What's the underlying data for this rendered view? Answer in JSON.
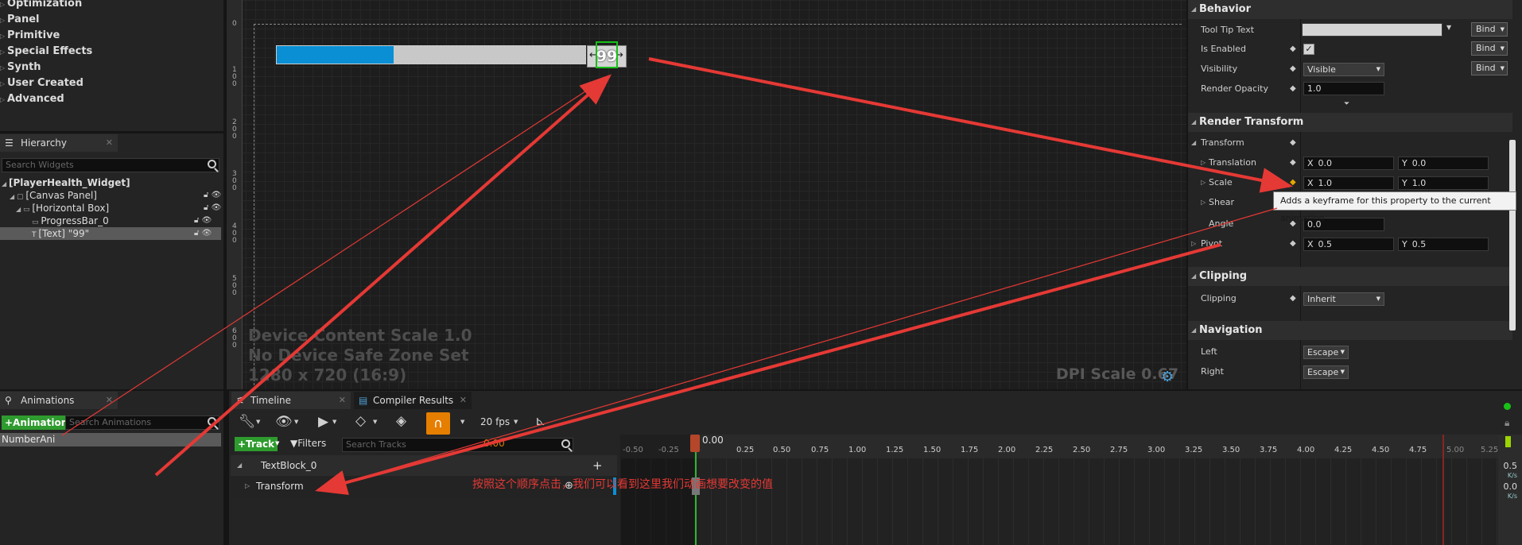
{
  "palette": {
    "items": [
      "Optimization",
      "Panel",
      "Primitive",
      "Special Effects",
      "Synth",
      "User Created",
      "Advanced"
    ]
  },
  "hierarchy": {
    "tab_label": "Hierarchy",
    "search_placeholder": "Search Widgets",
    "nodes": [
      "[PlayerHealth_Widget]",
      "[Canvas Panel]",
      "[Horizontal Box]",
      "ProgressBar_0",
      "[Text] \"99\""
    ]
  },
  "designer": {
    "text_value": "99",
    "progress_percent": 38,
    "info_lines": [
      "Device Content Scale 1.0",
      "No Device Safe Zone Set",
      "1280 x 720 (16:9)"
    ],
    "dpi_label": "DPI Scale 0.67",
    "ruler_labels": [
      "0",
      "1",
      "0",
      "0",
      "2",
      "0",
      "0",
      "3",
      "0",
      "0",
      "4",
      "0",
      "0",
      "5",
      "0",
      "0",
      "6",
      "0",
      "0"
    ]
  },
  "details": {
    "behavior": {
      "title": "Behavior",
      "tooltip_label": "Tool Tip Text",
      "enabled_label": "Is Enabled",
      "visibility_label": "Visibility",
      "visibility_value": "Visible",
      "opacity_label": "Render Opacity",
      "opacity_value": "1.0",
      "bind_label": "Bind"
    },
    "render_transform": {
      "title": "Render Transform",
      "transform_label": "Transform",
      "translation_label": "Translation",
      "translation_x": "0.0",
      "translation_y": "0.0",
      "scale_label": "Scale",
      "scale_x": "1.0",
      "scale_y": "1.0",
      "shear_label": "Shear",
      "angle_label": "Angle",
      "angle_value": "0.0",
      "pivot_label": "Pivot",
      "pivot_x": "0.5",
      "pivot_y": "0.5",
      "axis_x": "X",
      "axis_y": "Y"
    },
    "clipping": {
      "title": "Clipping",
      "label": "Clipping",
      "value": "Inherit"
    },
    "navigation": {
      "title": "Navigation",
      "left_label": "Left",
      "left_value": "Escape",
      "right_label": "Right",
      "right_value": "Escape"
    },
    "tooltip": "Adds a keyframe for this property to the current animation"
  },
  "animations": {
    "tab_label": "Animations",
    "add_button": "+Animation",
    "search_placeholder": "Search Animations",
    "items": [
      "NumberAni"
    ]
  },
  "timeline": {
    "tabs": [
      "Timeline",
      "Compiler Results"
    ],
    "fps": "20 fps",
    "track_button": "+Track",
    "filters_button": "Filters",
    "search_placeholder": "Search Tracks",
    "current_time_value": "0.00",
    "playhead_time": "0.00",
    "tracks": [
      "TextBlock_0",
      "Transform"
    ],
    "ticks": [
      "-0.50",
      "-0.25",
      "0.25",
      "0.50",
      "0.75",
      "1.00",
      "1.25",
      "1.50",
      "1.75",
      "2.00",
      "2.25",
      "2.50",
      "2.75",
      "3.00",
      "3.25",
      "3.50",
      "3.75",
      "4.00",
      "4.25",
      "4.50",
      "4.75",
      "5.00",
      "5.25"
    ],
    "annotation": "按照这个顺序点击，我们可以看到这里我们动画想要改变的值",
    "side_values": [
      "0.5",
      "K/s",
      "0.0",
      "K/s"
    ]
  },
  "colors": {
    "accent_orange": "#e67e00",
    "progress_blue": "#0a8fd4",
    "arrow_red": "#e53935",
    "add_green": "#2e9b2e"
  }
}
